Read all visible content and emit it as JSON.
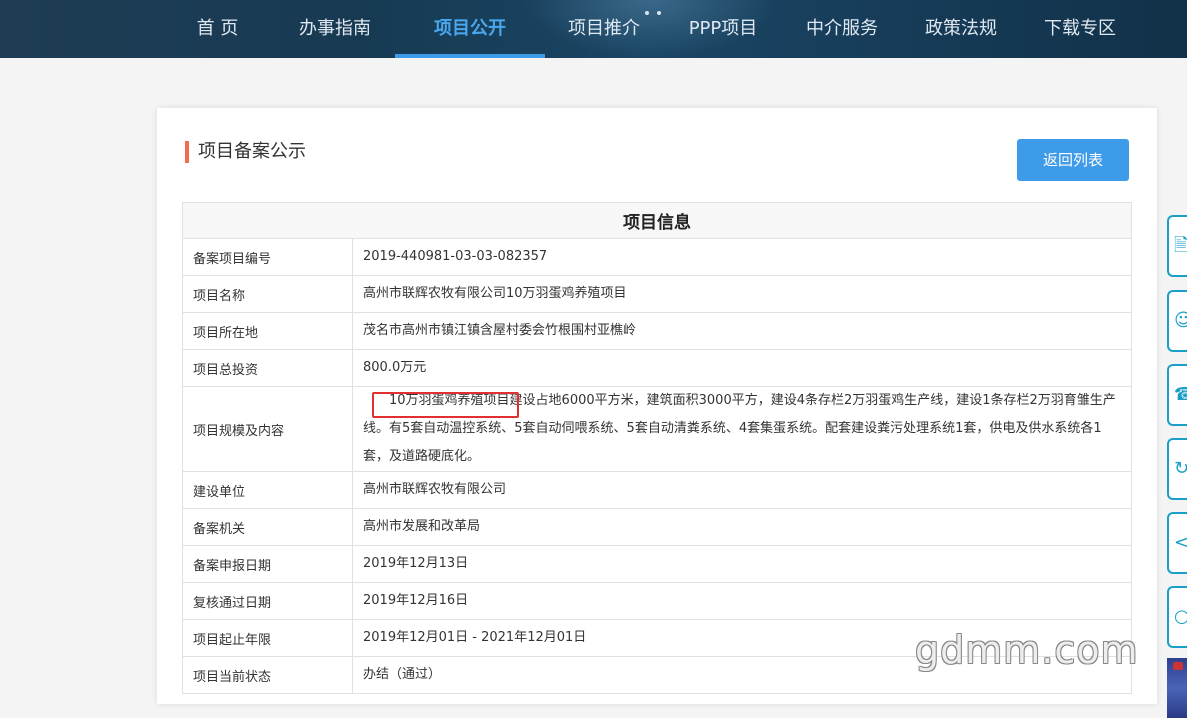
{
  "nav": {
    "items": [
      {
        "label": "首 页"
      },
      {
        "label": "办事指南"
      },
      {
        "label": "项目公开"
      },
      {
        "label": "项目推介"
      },
      {
        "label": "PPP项目"
      },
      {
        "label": "中介服务"
      },
      {
        "label": "政策法规"
      },
      {
        "label": "下载专区"
      }
    ],
    "active_index": 2
  },
  "section_title": "项目备案公示",
  "back_button": "返回列表",
  "table": {
    "header": "项目信息",
    "rows": [
      {
        "key": "备案项目编号",
        "value": "2019-440981-03-03-082357"
      },
      {
        "key": "项目名称",
        "value": "高州市联辉农牧有限公司10万羽蛋鸡养殖项目"
      },
      {
        "key": "项目所在地",
        "value": "茂名市高州市镇江镇含屋村委会竹根围村亚樵岭"
      },
      {
        "key": "项目总投资",
        "value": "800.0万元"
      },
      {
        "key": "项目规模及内容",
        "highlight": "10万羽蛋鸡养殖项目",
        "value": "建设占地6000平方米，建筑面积3000平方，建设4条存栏2万羽蛋鸡生产线，建设1条存栏2万羽育雏生产线。有5套自动温控系统、5套自动伺喂系统、5套自动清粪系统、4套集蛋系统。配套建设粪污处理系统1套，供电及供水系统各1套，及道路硬底化。"
      },
      {
        "key": "建设单位",
        "value": "高州市联辉农牧有限公司"
      },
      {
        "key": "备案机关",
        "value": "高州市发展和改革局"
      },
      {
        "key": "备案申报日期",
        "value": "2019年12月13日"
      },
      {
        "key": "复核通过日期",
        "value": "2019年12月16日"
      },
      {
        "key": "项目起止年限",
        "value": "2019年12月01日 - 2021年12月01日"
      },
      {
        "key": "项目当前状态",
        "value": "办结（通过）"
      }
    ]
  },
  "watermark": "gdmm.com",
  "colors": {
    "nav_active": "#3d9be9",
    "title_accent": "#f26a4f",
    "button": "#3d9be9",
    "highlight_border": "#e03030"
  }
}
